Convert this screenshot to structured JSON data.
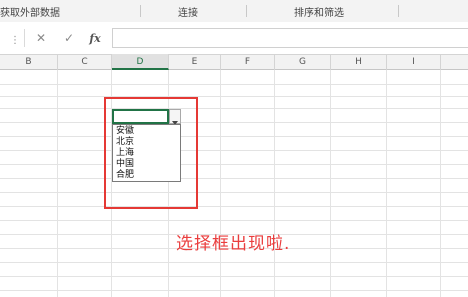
{
  "ribbon": {
    "groups": [
      "获取外部数据",
      "连接",
      "排序和筛选"
    ]
  },
  "formula_bar": {
    "cancel_symbol": "✕",
    "enter_symbol": "✓",
    "fx_label": "fx",
    "value": ""
  },
  "columns": [
    "B",
    "C",
    "D",
    "E",
    "F",
    "G",
    "H",
    "I"
  ],
  "active_column": "D",
  "dropdown": {
    "items": [
      "安徽",
      "北京",
      "上海",
      "中国",
      "合肥"
    ]
  },
  "annotation": "选择框出现啦.",
  "colors": {
    "accent_green": "#217346",
    "highlight_red": "#e53935",
    "annotation_red": "#ea3e3e"
  }
}
